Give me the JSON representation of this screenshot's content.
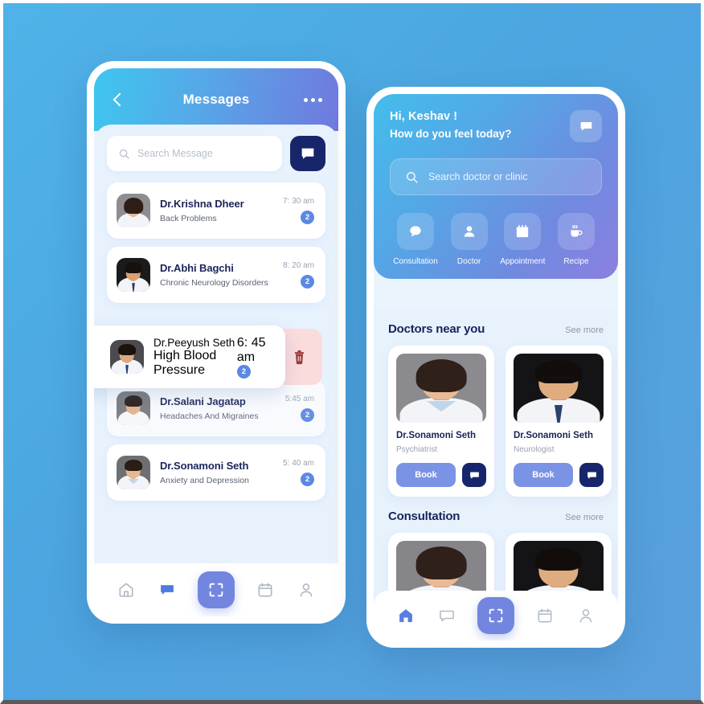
{
  "theme": {
    "canvas_bg": "#4CA5E0",
    "header_gradient_start": "#3EC6EF",
    "header_gradient_end": "#7079DE",
    "accent_purple": "#7286E0",
    "navy": "#17266B",
    "badge_blue": "#5B88E4",
    "delete_bg": "#FBDCDC",
    "delete_icon": "#A03A3A",
    "screen_bg": "#E8F2FD"
  },
  "messages_screen": {
    "header": {
      "back_icon": "chevron-left-icon",
      "title": "Messages",
      "more_icon": "more-horizontal-icon"
    },
    "search": {
      "icon": "search-icon",
      "placeholder": "Search Message"
    },
    "compose_button_icon": "chat-bubble-icon",
    "conversations": [
      {
        "name": "Dr.Krishna Dheer",
        "subject": "Back Problems",
        "time": "7: 30 am",
        "unread": "2",
        "avatar": "female-doctor-photo"
      },
      {
        "name": "Dr.Abhi Bagchi",
        "subject": "Chronic Neurology Disorders",
        "time": "8: 20 am",
        "unread": "2",
        "avatar": "male-doctor-photo"
      },
      {
        "name": "Dr.Peeyush Seth",
        "subject": "High Blood Pressure",
        "time": "6: 45 am",
        "unread": "2",
        "avatar": "male-doctor-photo",
        "swiped": true,
        "delete_icon": "trash-icon"
      },
      {
        "name": "Dr.Salani Jagatap",
        "subject": "Headaches And Migraines",
        "time": "5:45 am",
        "unread": "2",
        "avatar": "male-doctor-photo"
      },
      {
        "name": "Dr.Sonamoni Seth",
        "subject": "Anxiety and Depression",
        "time": "5: 40 am",
        "unread": "2",
        "avatar": "female-doctor-photo"
      }
    ],
    "bottom_nav": [
      {
        "icon": "home-icon",
        "active": false
      },
      {
        "icon": "chat-icon",
        "active": true
      },
      {
        "icon": "scan-icon",
        "active": true
      },
      {
        "icon": "calendar-icon",
        "active": false
      },
      {
        "icon": "person-icon",
        "active": false
      }
    ]
  },
  "home_screen": {
    "greeting": "Hi, Keshav !",
    "question": "How do you feel today?",
    "chat_button_icon": "chat-bubble-icon",
    "search": {
      "icon": "search-icon",
      "placeholder": "Search doctor or clinic"
    },
    "quick_actions": [
      {
        "label": "Consultation",
        "icon": "chat-bubble-icon"
      },
      {
        "label": "Doctor",
        "icon": "person-icon"
      },
      {
        "label": "Appointment",
        "icon": "calendar-icon"
      },
      {
        "label": "Recipe",
        "icon": "coffee-cup-icon"
      }
    ],
    "sections": [
      {
        "title": "Doctors near you",
        "see_more": "See more",
        "doctors": [
          {
            "name": "Dr.Sonamoni Seth",
            "specialty": "Psychiatrist",
            "book_label": "Book",
            "chat_icon": "chat-bubble-icon",
            "photo": "female-doctor-photo"
          },
          {
            "name": "Dr.Sonamoni Seth",
            "specialty": "Neurologist",
            "book_label": "Book",
            "chat_icon": "chat-bubble-icon",
            "photo": "male-doctor-photo"
          }
        ]
      },
      {
        "title": "Consultation",
        "see_more": "See more",
        "doctors": [
          {
            "photo": "female-doctor-photo"
          },
          {
            "photo": "male-doctor-photo"
          }
        ]
      }
    ],
    "bottom_nav": [
      {
        "icon": "home-icon",
        "active": true
      },
      {
        "icon": "chat-icon",
        "active": false
      },
      {
        "icon": "scan-icon",
        "active": true
      },
      {
        "icon": "calendar-icon",
        "active": false
      },
      {
        "icon": "person-icon",
        "active": false
      }
    ]
  }
}
